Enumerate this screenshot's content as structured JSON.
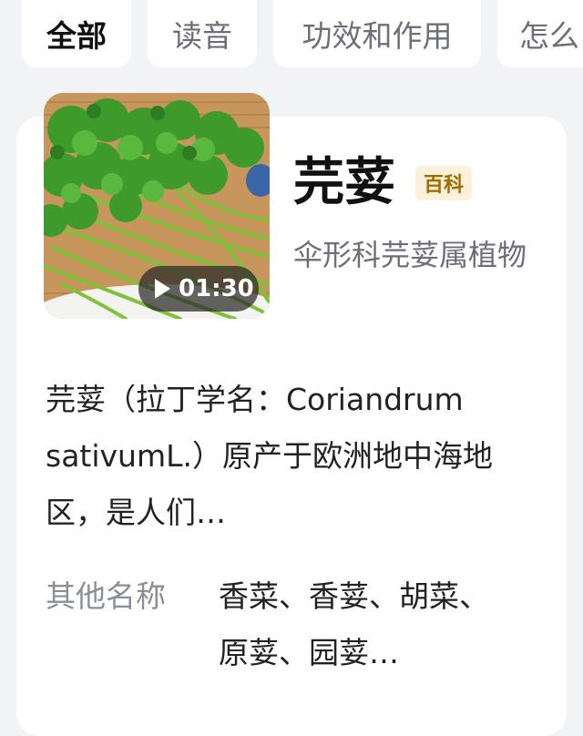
{
  "tabs": [
    {
      "label": "全部",
      "active": true
    },
    {
      "label": "读音",
      "active": false
    },
    {
      "label": "功效和作用",
      "active": false
    },
    {
      "label": "怎么",
      "active": false
    }
  ],
  "entry": {
    "title": "芫荽",
    "badge": "百科",
    "subtitle": "伞形科芫荽属植物",
    "video_duration": "01:30",
    "description": "芫荽（拉丁学名：Coriandrum sativumL.）原产于欧洲地中海地区，是人们…",
    "alias_label": "其他名称",
    "alias_value": "香菜、香荽、胡菜、原荽、园荽…"
  },
  "colors": {
    "page_background": "#f2f3f7",
    "badge_background": "#fbf1db",
    "badge_text": "#a16c00"
  },
  "icons": [
    "play-icon"
  ]
}
